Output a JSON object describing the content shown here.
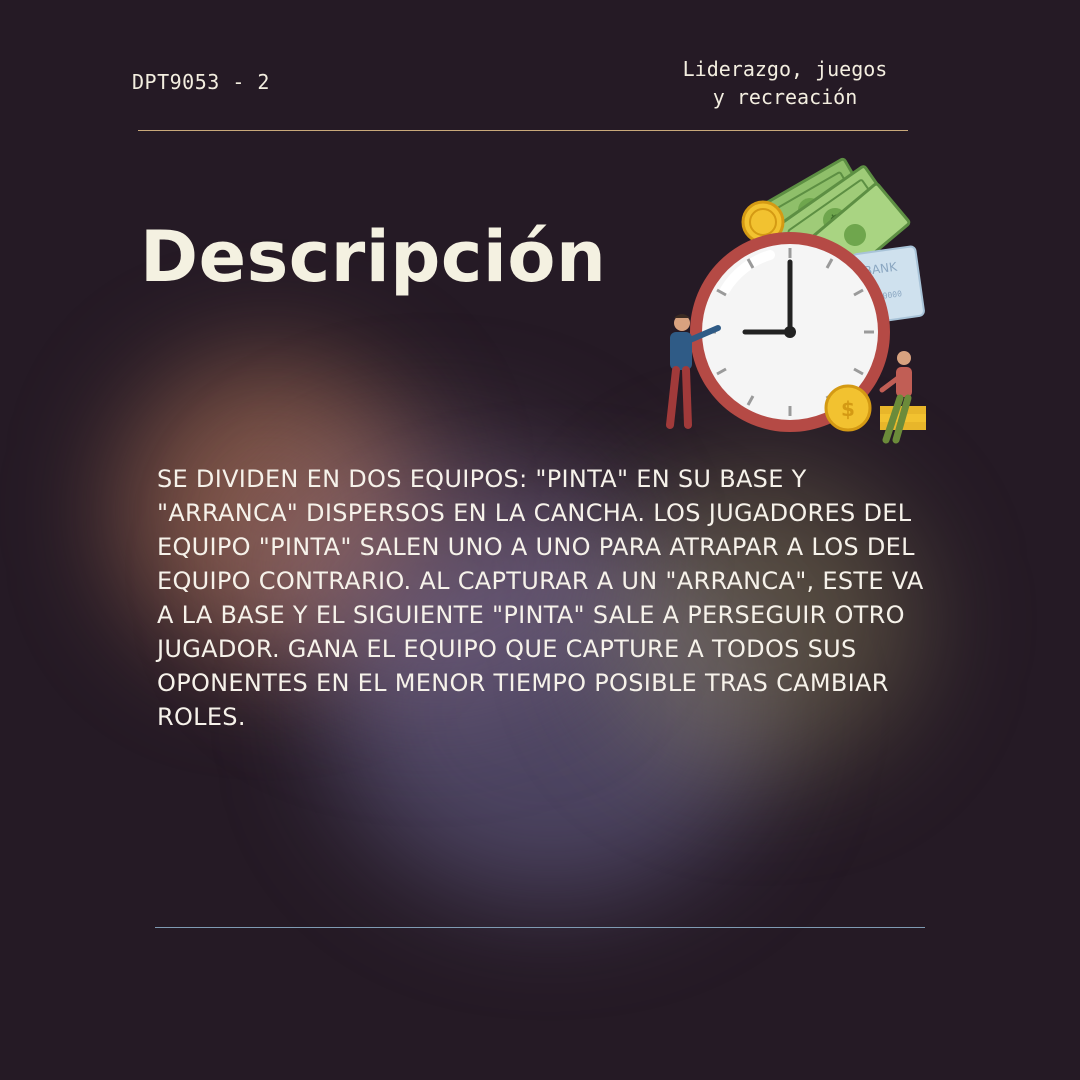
{
  "header": {
    "code": "DPT9053 - 2",
    "subject_line1": "Liderazgo, juegos",
    "subject_line2": "y recreación"
  },
  "title": "Descripción",
  "body": "SE DIVIDEN EN DOS EQUIPOS: \"PINTA\" EN SU BASE Y \"ARRANCA\" DISPERSOS EN LA CANCHA. LOS JUGADORES DEL EQUIPO \"PINTA\" SALEN UNO A UNO PARA ATRAPAR A LOS DEL EQUIPO CONTRARIO. AL CAPTURAR A UN \"ARRANCA\", ESTE VA A LA BASE Y EL SIGUIENTE \"PINTA\" SALE A PERSEGUIR OTRO JUGADOR. GANA EL EQUIPO QUE CAPTURE A TODOS SUS OPONENTES EN EL MENOR TIEMPO POSIBLE TRAS CAMBIAR ROLES.",
  "illustration": {
    "icons": [
      "clock-icon",
      "money-icon",
      "coin-icon",
      "bank-card-icon",
      "person-icon"
    ],
    "bank_card_label": "BANK",
    "bank_card_number": "000 0000"
  },
  "colors": {
    "background": "#251a25",
    "text": "#f4f1e1",
    "rule_top": "#c9a97a",
    "rule_bottom": "#7f9bb3"
  }
}
